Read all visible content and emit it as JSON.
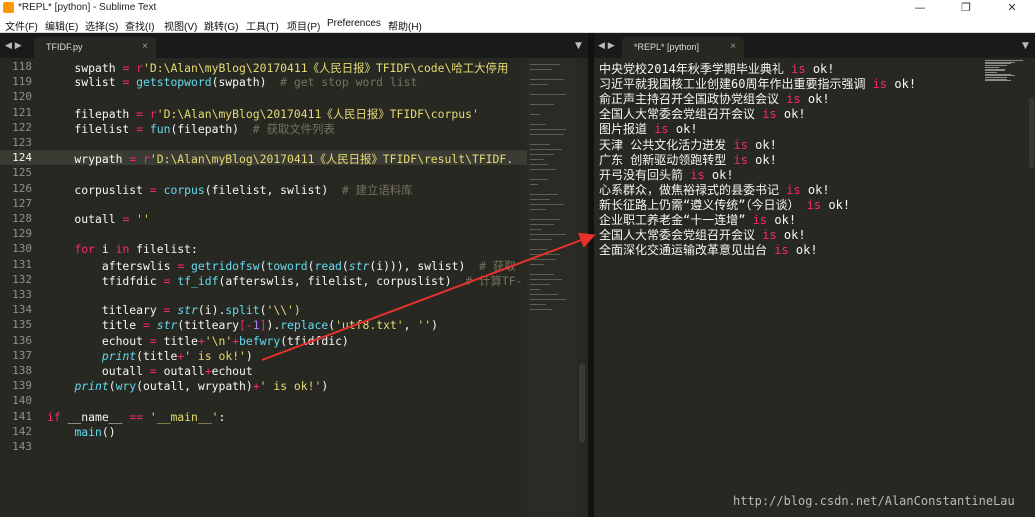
{
  "window": {
    "title": "*REPL* [python] - Sublime Text",
    "controls": [
      "—",
      "❐",
      "✕"
    ]
  },
  "menu": [
    "文件(F)",
    "编辑(E)",
    "选择(S)",
    "查找(I)",
    "视图(V)",
    "跳转(G)",
    "工具(T)",
    "项目(P)",
    "Preferences",
    "帮助(H)"
  ],
  "editor": {
    "tab_label": "TFIDF.py",
    "tab_close": "×",
    "nav_left": "◀ ▶",
    "nav_down": "▼",
    "current_line": "124",
    "lines": [
      {
        "n": "118",
        "code": "    swpath = r'D:\\Alan\\myBlog\\20170411《人民日报》TFIDF\\code\\哈工大停用"
      },
      {
        "n": "119",
        "code": "    swlist = getstopword(swpath)  # get stop word list"
      },
      {
        "n": "120",
        "code": ""
      },
      {
        "n": "121",
        "code": "    filepath = r'D:\\Alan\\myBlog\\20170411《人民日报》TFIDF\\corpus'"
      },
      {
        "n": "122",
        "code": "    filelist = fun(filepath)  # 获取文件列表"
      },
      {
        "n": "123",
        "code": ""
      },
      {
        "n": "124",
        "code": "    wrypath = r'D:\\Alan\\myBlog\\20170411《人民日报》TFIDF\\result\\TFIDF."
      },
      {
        "n": "125",
        "code": ""
      },
      {
        "n": "126",
        "code": "    corpuslist = corpus(filelist, swlist)  # 建立语料库"
      },
      {
        "n": "127",
        "code": ""
      },
      {
        "n": "128",
        "code": "    outall = ''"
      },
      {
        "n": "129",
        "code": ""
      },
      {
        "n": "130",
        "code": "    for i in filelist:"
      },
      {
        "n": "131",
        "code": "        afterswlis = getridofsw(toword(read(str(i))), swlist)  # 获取"
      },
      {
        "n": "132",
        "code": "        tfidfdic = tf_idf(afterswlis, filelist, corpuslist)  # 计算TF-"
      },
      {
        "n": "133",
        "code": ""
      },
      {
        "n": "134",
        "code": "        titleary = str(i).split('\\\\')"
      },
      {
        "n": "135",
        "code": "        title = str(titleary[-1]).replace('utf8.txt', '')"
      },
      {
        "n": "136",
        "code": "        echout = title+'\\n'+befwry(tfidfdic)"
      },
      {
        "n": "137",
        "code": "        print(title+' is ok!')"
      },
      {
        "n": "138",
        "code": "        outall = outall+echout"
      },
      {
        "n": "139",
        "code": "    print(wry(outall, wrypath)+' is ok!')"
      },
      {
        "n": "140",
        "code": ""
      },
      {
        "n": "141",
        "code": "if __name__ == '__main__':"
      },
      {
        "n": "142",
        "code": "    main()"
      },
      {
        "n": "143",
        "code": ""
      }
    ]
  },
  "repl": {
    "tab_label": "*REPL* [python]",
    "tab_close": "×",
    "nav_left": "◀ ▶",
    "nav_down": "▼",
    "output": [
      {
        "title": "中央党校2014年秋季学期毕业典礼",
        "suffix": " is ok!"
      },
      {
        "title": "习近平就我国核工业创建60周年作出重要指示强调",
        "suffix": " is ok!"
      },
      {
        "title": "俞正声主持召开全国政协党组会议",
        "suffix": " is ok!"
      },
      {
        "title": "全国人大常委会党组召开会议",
        "suffix": " is ok!"
      },
      {
        "title": "图片报道",
        "suffix": " is ok!"
      },
      {
        "title": "天津 公共文化活力迸发",
        "suffix": " is ok!"
      },
      {
        "title": "广东 创新驱动领跑转型",
        "suffix": " is ok!"
      },
      {
        "title": "开弓没有回头箭",
        "suffix": " is ok!"
      },
      {
        "title": "心系群众，做焦裕禄式的县委书记",
        "suffix": " is ok!"
      },
      {
        "title": "新长征路上仍需“遵义传统”（今日谈）",
        "suffix": " is ok!"
      },
      {
        "title": "企业职工养老金“十一连增”",
        "suffix": " is ok!"
      },
      {
        "title": "全国人大常委会党组召开会议",
        "suffix": " is ok!"
      },
      {
        "title": "全面深化交通运输改革意见出台",
        "suffix": " is ok!"
      }
    ]
  },
  "watermark": "http://blog.csdn.net/AlanConstantineLau",
  "colors": {
    "background": "#272822",
    "keyword": "#f92672",
    "function": "#66d9ef",
    "string": "#e6db74",
    "comment": "#75715e",
    "number": "#ae81ff",
    "annotation_arrow": "#e8312a"
  }
}
